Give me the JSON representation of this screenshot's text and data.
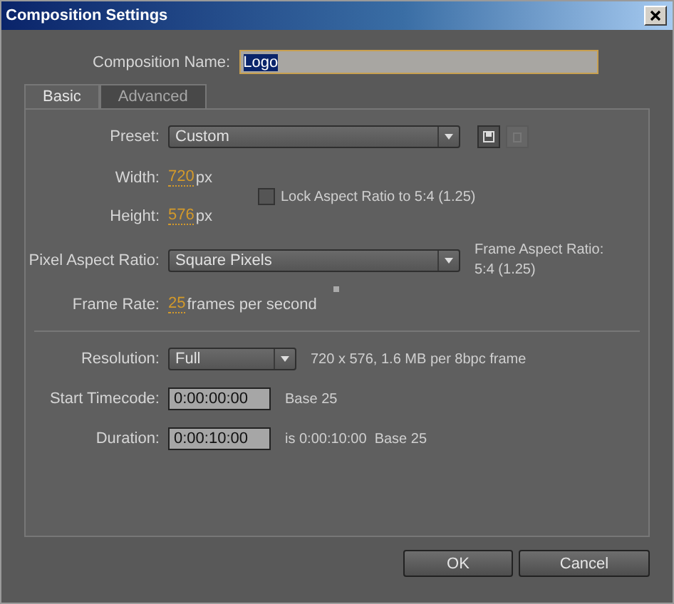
{
  "window": {
    "title": "Composition Settings"
  },
  "composition_name": {
    "label": "Composition Name:",
    "value": "Logo"
  },
  "tabs": [
    {
      "label": "Basic",
      "selected": true
    },
    {
      "label": "Advanced",
      "selected": false
    }
  ],
  "preset": {
    "label": "Preset:",
    "value": "Custom"
  },
  "width": {
    "label": "Width:",
    "value": "720",
    "unit": "px"
  },
  "height": {
    "label": "Height:",
    "value": "576",
    "unit": "px"
  },
  "lock_aspect_ratio": {
    "label": "Lock Aspect Ratio to 5:4 (1.25)",
    "checked": false
  },
  "pixel_aspect_ratio": {
    "label": "Pixel Aspect Ratio:",
    "value": "Square Pixels"
  },
  "frame_aspect_ratio": {
    "label": "Frame Aspect Ratio:",
    "value": "5:4 (1.25)"
  },
  "frame_rate": {
    "label": "Frame Rate:",
    "value": "25",
    "unit": "frames per second"
  },
  "resolution": {
    "label": "Resolution:",
    "value": "Full",
    "info": "720 x 576, 1.6 MB per 8bpc frame"
  },
  "start_timecode": {
    "label": "Start Timecode:",
    "value": "0:00:00:00",
    "note": "Base 25"
  },
  "duration": {
    "label": "Duration:",
    "value": "0:00:10:00",
    "note": "is 0:00:10:00  Base 25"
  },
  "buttons": [
    "OK",
    "Cancel"
  ]
}
